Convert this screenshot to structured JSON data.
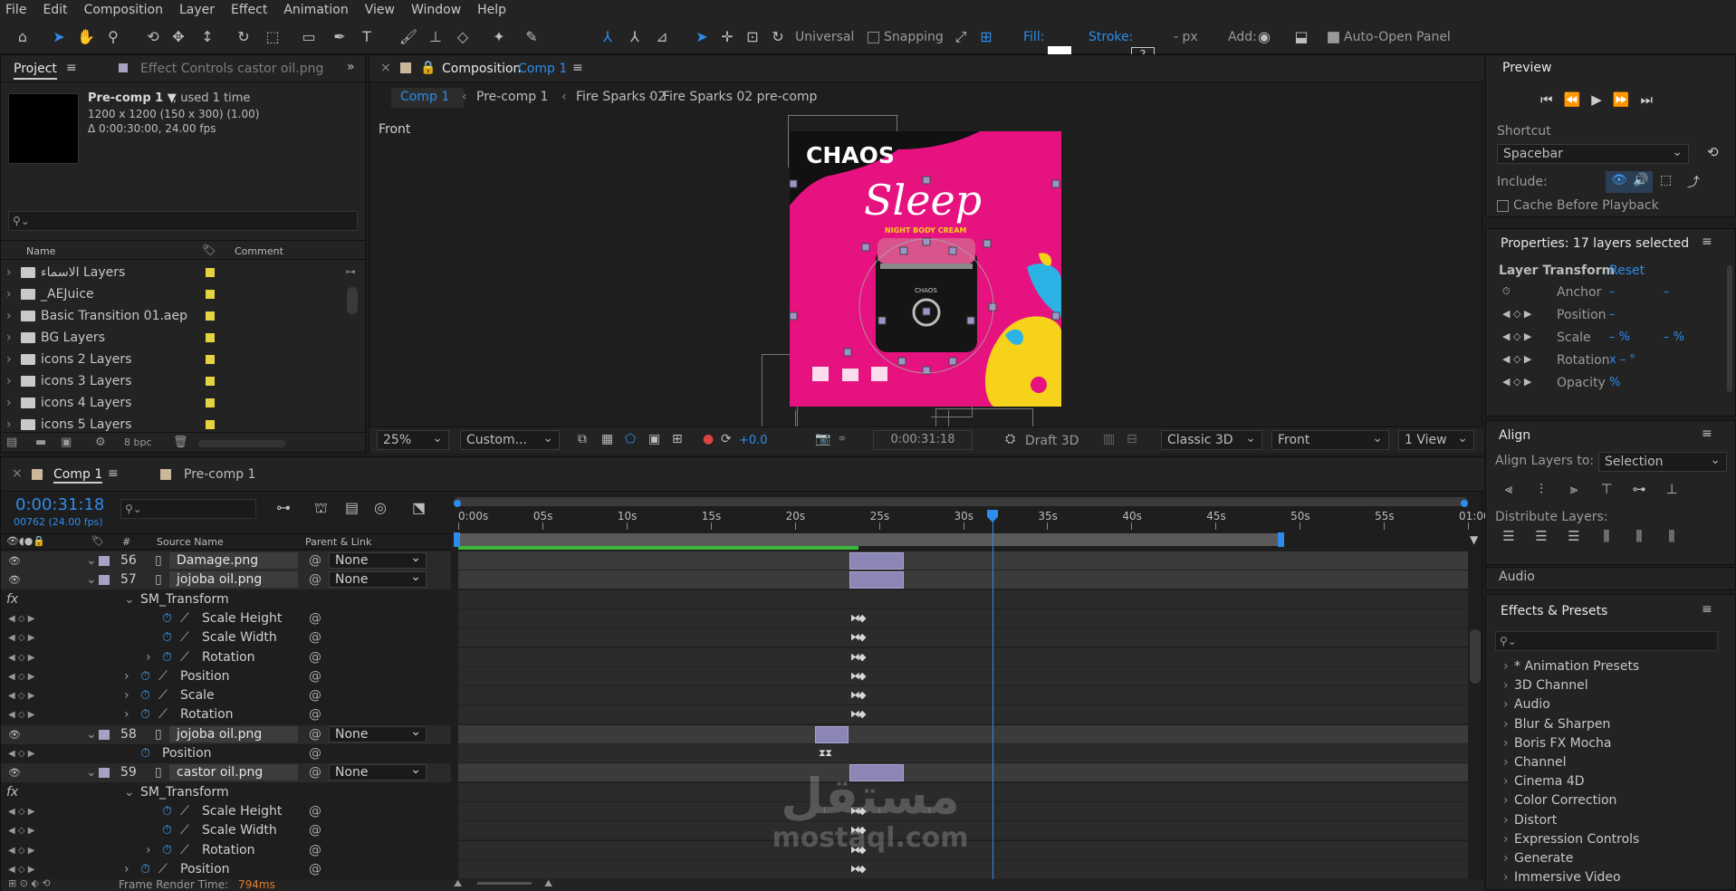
{
  "menu": [
    "File",
    "Edit",
    "Composition",
    "Layer",
    "Effect",
    "Animation",
    "View",
    "Window",
    "Help"
  ],
  "toolbar": {
    "view_axis": "Universal",
    "snapping": "Snapping",
    "fill_label": "Fill:",
    "stroke_label": "Stroke:",
    "stroke_value": "?",
    "px_label": "- px",
    "add_label": "Add:",
    "auto_open": "Auto-Open Panel"
  },
  "project": {
    "tab_label": "Project",
    "effect_controls_label": "Effect Controls castor oil.png",
    "comp_name": "Pre-comp 1 ▼",
    "comp_used": ", used 1 time",
    "comp_size": "1200 x 1200  (150 x 300) (1.00)",
    "comp_duration": "Δ 0:00:30:00, 24.00 fps",
    "col_name": "Name",
    "col_comment": "Comment",
    "items": [
      "الاسماء Layers",
      "_AEJuice",
      "Basic Transition 01.aep",
      "BG Layers",
      "icons 2 Layers",
      "icons 3 Layers",
      "icons 4 Layers",
      "icons 5 Layers"
    ],
    "bpc": "8 bpc"
  },
  "composition": {
    "tab_prefix": "Composition",
    "tab_name": "Comp 1",
    "breadcrumbs": [
      "Comp 1",
      "Pre-comp 1",
      "Fire Sparks 02",
      "Fire Sparks 02 pre-comp"
    ],
    "view_label": "Front",
    "zoom": "25%",
    "resolution": "Custom...",
    "exposure": "+0.0",
    "timecode": "0:00:31:18",
    "renderer": "Draft 3D",
    "renderer_type": "Classic 3D",
    "camera": "Front",
    "views": "1 View",
    "poster": {
      "brand": "CHAOS",
      "title": "Sleep",
      "subtitle": "NIGHT BODY CREAM",
      "jar_brand": "CHAOS",
      "colors": {
        "pink": "#e5127f",
        "black": "#111111",
        "yellow": "#f7d21b",
        "blue": "#2bb3e6",
        "jar_lid": "#d9548d"
      }
    }
  },
  "timeline": {
    "tabs": [
      "Comp 1",
      "Pre-comp 1"
    ],
    "timecode": "0:00:31:18",
    "frame_info": "00762 (24.00 fps)",
    "col_source": "Source Name",
    "col_parent": "Parent & Link",
    "ruler": [
      "0:00s",
      "05s",
      "10s",
      "15s",
      "20s",
      "25s",
      "30s",
      "35s",
      "40s",
      "45s",
      "50s",
      "55s",
      "01:00"
    ],
    "playhead_seconds": 31.75,
    "rows": [
      {
        "kind": "layer",
        "num": "56",
        "name": "Damage.png",
        "parent": "None"
      },
      {
        "kind": "layer",
        "num": "57",
        "name": "jojoba oil.png",
        "parent": "None"
      },
      {
        "kind": "effect",
        "name": "SM_Transform"
      },
      {
        "kind": "prop",
        "name": "Scale Height"
      },
      {
        "kind": "prop",
        "name": "Scale Width"
      },
      {
        "kind": "prop",
        "name": "Rotation"
      },
      {
        "kind": "prop2",
        "name": "Position"
      },
      {
        "kind": "prop2",
        "name": "Scale"
      },
      {
        "kind": "prop2",
        "name": "Rotation"
      },
      {
        "kind": "layer",
        "num": "58",
        "name": "jojoba oil.png",
        "parent": "None"
      },
      {
        "kind": "prop3",
        "name": "Position"
      },
      {
        "kind": "layer",
        "num": "59",
        "name": "castor oil.png",
        "parent": "None"
      },
      {
        "kind": "effect",
        "name": "SM_Transform"
      },
      {
        "kind": "prop",
        "name": "Scale Height"
      },
      {
        "kind": "prop",
        "name": "Scale Width"
      },
      {
        "kind": "prop",
        "name": "Rotation"
      },
      {
        "kind": "prop2",
        "name": "Position"
      }
    ],
    "render_time_label": "Frame Render Time:",
    "render_time_value": "794ms",
    "watermark_ar": "مستقل",
    "watermark_en": "mostaql.com"
  },
  "preview": {
    "title": "Preview",
    "shortcut_label": "Shortcut",
    "shortcut_value": "Spacebar",
    "include_label": "Include:",
    "cache_label": "Cache Before Playback"
  },
  "properties": {
    "title": "Properties: 17 layers selected",
    "section": "Layer Transform",
    "reset": "Reset",
    "rows": [
      {
        "name": "Anchor",
        "v1": "–",
        "v2": "–"
      },
      {
        "name": "Position",
        "v1": "–",
        "v2": ""
      },
      {
        "name": "Scale",
        "v1": "– %",
        "v2": "– %"
      },
      {
        "name": "Rotation",
        "v1": "x – °",
        "v2": ""
      },
      {
        "name": "Opacity",
        "v1": "%",
        "v2": ""
      }
    ]
  },
  "align": {
    "title": "Align",
    "align_to_label": "Align Layers to:",
    "align_to_value": "Selection",
    "distribute_label": "Distribute Layers:"
  },
  "audio": {
    "title": "Audio"
  },
  "effects": {
    "title": "Effects & Presets",
    "items": [
      "* Animation Presets",
      "3D Channel",
      "Audio",
      "Blur & Sharpen",
      "Boris FX Mocha",
      "Channel",
      "Cinema 4D",
      "Color Correction",
      "Distort",
      "Expression Controls",
      "Generate",
      "Immersive Video"
    ]
  }
}
